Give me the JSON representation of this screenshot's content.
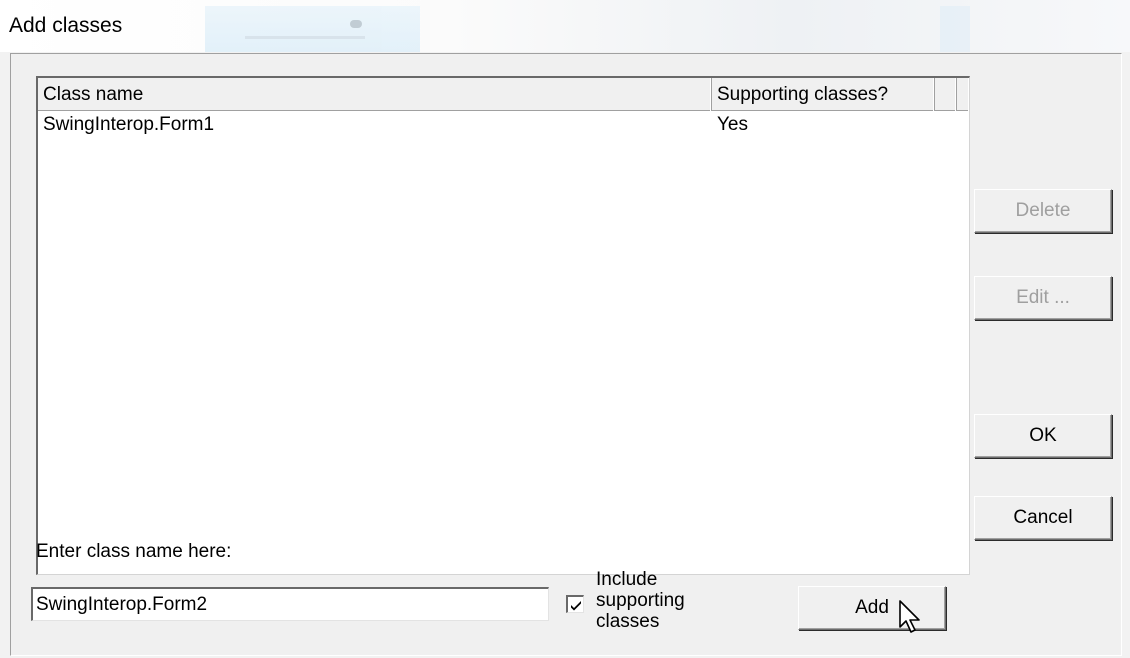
{
  "window": {
    "title": "Add classes"
  },
  "list": {
    "columns": {
      "class_name": "Class name",
      "supporting": "Supporting classes?"
    },
    "rows": [
      {
        "class_name": "SwingInterop.Form1",
        "supporting": "Yes"
      }
    ]
  },
  "buttons": {
    "delete": "Delete",
    "edit": "Edit ...",
    "ok": "OK",
    "cancel": "Cancel",
    "add": "Add"
  },
  "entry": {
    "label": "Enter class name here:",
    "value": "SwingInterop.Form2",
    "checkbox_label": "Include supporting classes",
    "checkbox_checked": true
  },
  "icons": {
    "checkmark": "checkmark-icon",
    "cursor": "mouse-pointer-icon"
  }
}
